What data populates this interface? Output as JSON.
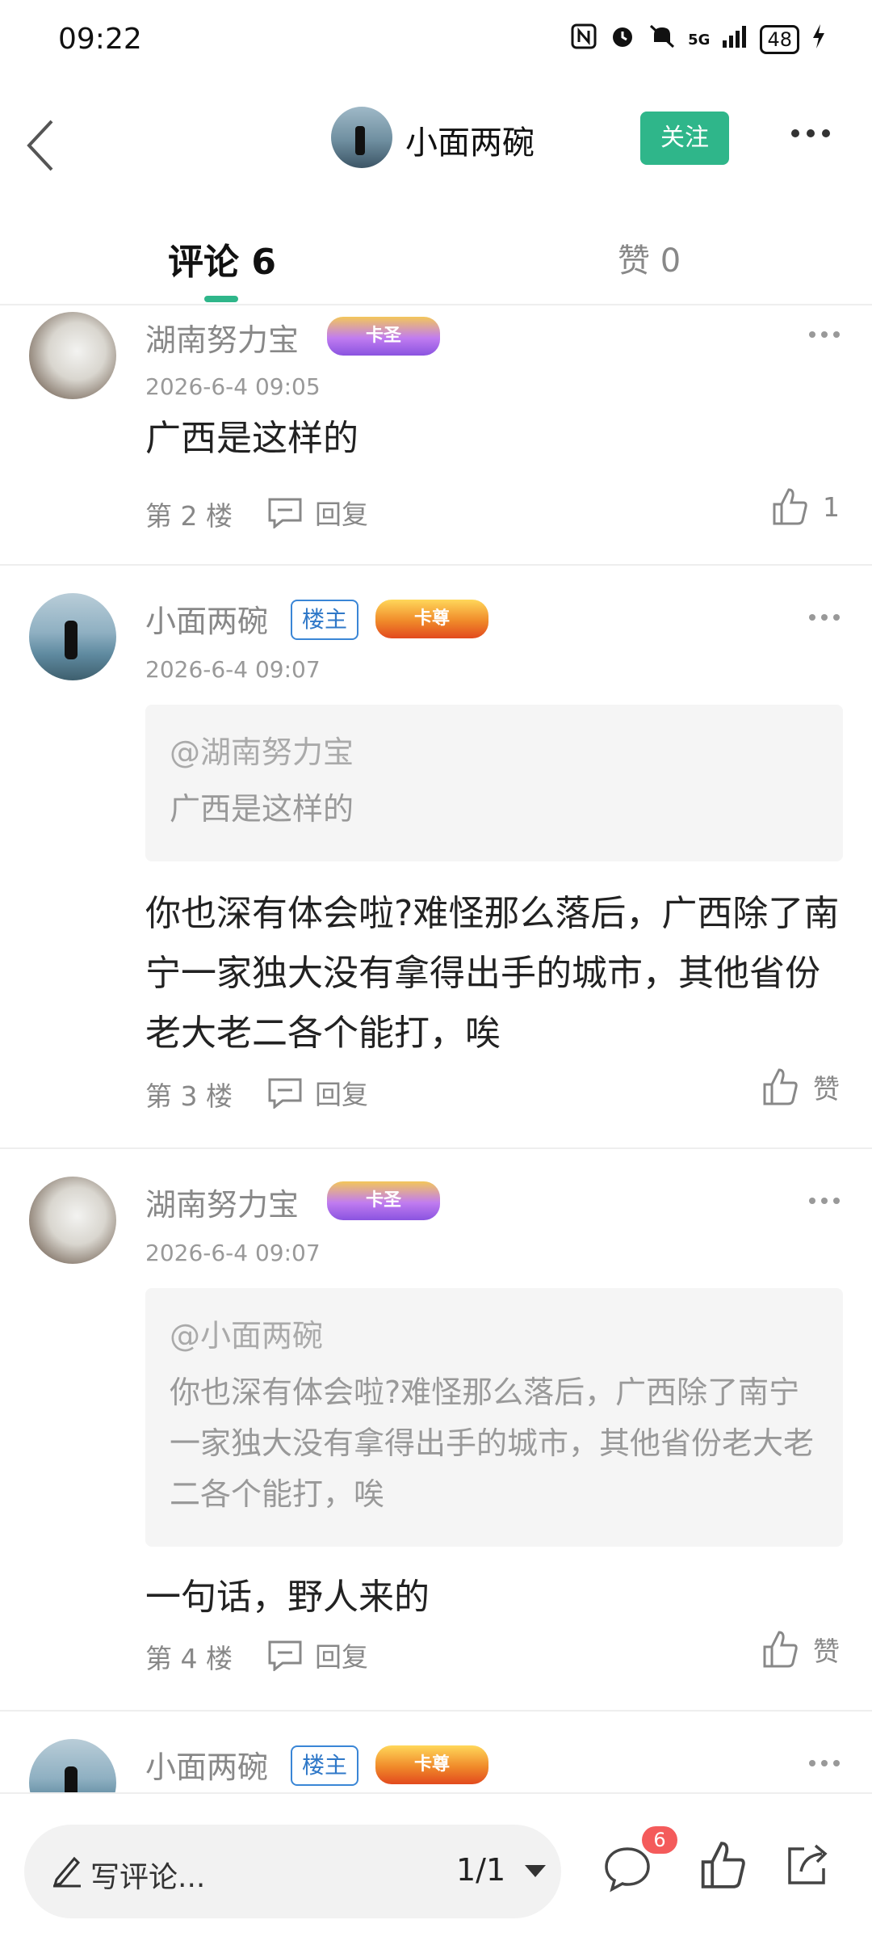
{
  "status_bar": {
    "time": "09:22",
    "network": "5G",
    "battery": "48",
    "icons": [
      "nfc-icon",
      "alarm-icon",
      "silent-icon",
      "signal-icon",
      "battery-icon",
      "charging-icon"
    ]
  },
  "nav": {
    "title": "小面两碗",
    "follow_label": "关注"
  },
  "tabs": {
    "comments_label": "评论 6",
    "likes_label": "赞 0"
  },
  "comments": [
    {
      "user": "湖南努力宝",
      "crown": "卡圣",
      "time": "2026-6-4 09:05",
      "text": "广西是这样的",
      "floor": "第 2 楼",
      "reply_label": "回复",
      "like_label": "1"
    },
    {
      "user": "小面两碗",
      "host_badge": "楼主",
      "crown": "卡尊",
      "time": "2026-6-4 09:07",
      "quote_user": "@湖南努力宝",
      "quote_text": "广西是这样的",
      "text": "你也深有体会啦?难怪那么落后，广西除了南宁一家独大没有拿得出手的城市，其他省份老大老二各个能打，唉",
      "floor": "第 3 楼",
      "reply_label": "回复",
      "like_label": "赞"
    },
    {
      "user": "湖南努力宝",
      "crown": "卡圣",
      "time": "2026-6-4 09:07",
      "quote_user": "@小面两碗",
      "quote_text": "你也深有体会啦?难怪那么落后，广西除了南宁一家独大没有拿得出手的城市，其他省份老大老二各个能打，唉",
      "text": "一句话，野人来的",
      "floor": "第 4 楼",
      "reply_label": "回复",
      "like_label": "赞"
    },
    {
      "user": "小面两碗",
      "host_badge": "楼主",
      "crown": "卡尊"
    }
  ],
  "bottom_bar": {
    "placeholder": "写评论...",
    "page": "1/1",
    "comment_count": "6"
  },
  "colors": {
    "accent": "#2fb68a",
    "notification": "#f45b5b",
    "host_badge": "#3a86d6"
  }
}
